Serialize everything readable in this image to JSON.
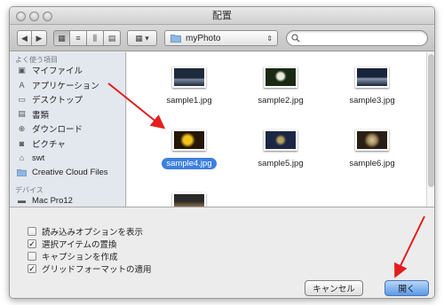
{
  "window": {
    "title": "配置"
  },
  "toolbar": {
    "back_icon": "chevron-left-icon",
    "forward_icon": "chevron-right-icon",
    "view_modes": [
      "icon-view-icon",
      "list-view-icon",
      "column-view-icon",
      "coverflow-view-icon"
    ],
    "arrange_icon": "grid-arrange-icon",
    "location": "myPhoto",
    "search": {
      "value": "",
      "placeholder": ""
    }
  },
  "sidebar": {
    "favorites_header": "よく使う項目",
    "favorites": [
      {
        "label": "マイファイル",
        "icon": "all-my-files-icon"
      },
      {
        "label": "アプリケーション",
        "icon": "applications-icon"
      },
      {
        "label": "デスクトップ",
        "icon": "desktop-icon"
      },
      {
        "label": "書類",
        "icon": "documents-icon"
      },
      {
        "label": "ダウンロード",
        "icon": "downloads-icon"
      },
      {
        "label": "ピクチャ",
        "icon": "pictures-icon"
      },
      {
        "label": "swt",
        "icon": "home-icon"
      },
      {
        "label": "Creative Cloud Files",
        "icon": "folder-icon"
      }
    ],
    "devices_header": "デバイス",
    "devices": [
      {
        "label": "Mac Pro12",
        "icon": "computer-icon"
      }
    ]
  },
  "files": [
    {
      "name": "sample1.jpg",
      "selected": false,
      "colors": [
        "#1d2a3a",
        "#7d8aa0"
      ]
    },
    {
      "name": "sample2.jpg",
      "selected": false,
      "colors": [
        "#1a2a12",
        "#e9ecdc"
      ]
    },
    {
      "name": "sample3.jpg",
      "selected": false,
      "colors": [
        "#17243a",
        "#8a97ad"
      ]
    },
    {
      "name": "sample4.jpg",
      "selected": true,
      "colors": [
        "#241608",
        "#f4c21d"
      ]
    },
    {
      "name": "sample5.jpg",
      "selected": false,
      "colors": [
        "#1b2744",
        "#b8a35a"
      ]
    },
    {
      "name": "sample6.jpg",
      "selected": false,
      "colors": [
        "#2a1f16",
        "#d8c9a4"
      ]
    },
    {
      "name": "",
      "selected": false,
      "colors": [
        "#2a2a2a",
        "#8a6d46"
      ]
    }
  ],
  "options": [
    {
      "label": "読み込みオプションを表示",
      "checked": false
    },
    {
      "label": "選択アイテムの置換",
      "checked": true
    },
    {
      "label": "キャプションを作成",
      "checked": false
    },
    {
      "label": "グリッドフォーマットの適用",
      "checked": true
    }
  ],
  "buttons": {
    "cancel": "キャンセル",
    "open": "開く"
  },
  "colors": {
    "selection": "#3d80df",
    "sidebar_bg": "#e3e8ee",
    "annotation_arrow": "#e41e1e"
  }
}
